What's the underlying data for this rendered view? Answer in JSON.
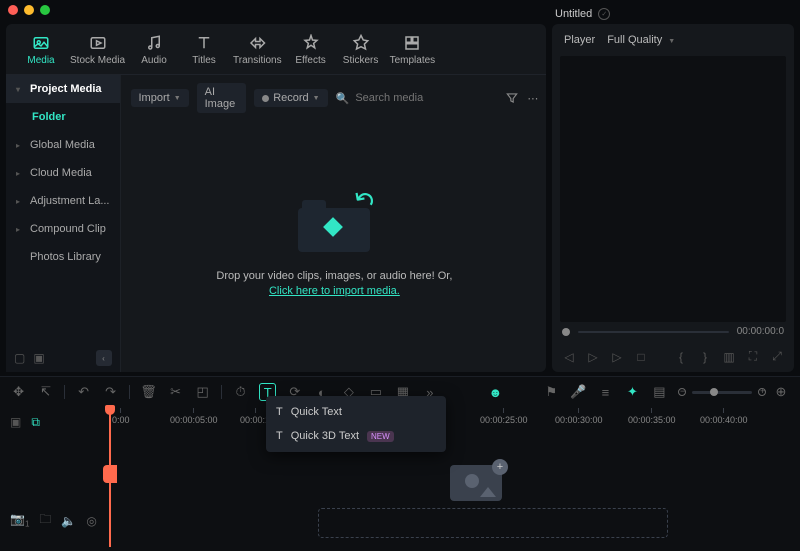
{
  "title": "Untitled",
  "tabs": [
    {
      "label": "Media"
    },
    {
      "label": "Stock Media"
    },
    {
      "label": "Audio"
    },
    {
      "label": "Titles"
    },
    {
      "label": "Transitions"
    },
    {
      "label": "Effects"
    },
    {
      "label": "Stickers"
    },
    {
      "label": "Templates"
    }
  ],
  "sidebar": {
    "project": "Project Media",
    "folder": "Folder",
    "items": [
      "Global Media",
      "Cloud Media",
      "Adjustment La...",
      "Compound Clip",
      "Photos Library"
    ]
  },
  "toolbar": {
    "import": "Import",
    "aiImage": "AI Image",
    "record": "Record",
    "searchPlaceholder": "Search media"
  },
  "dropzone": {
    "line1": "Drop your video clips, images, or audio here! Or,",
    "link": "Click here to import media."
  },
  "player": {
    "label": "Player",
    "quality": "Full Quality",
    "time": "00:00:00:0"
  },
  "timeline": {
    "marks": [
      "0:00",
      "00:00:05:00",
      "00:00:1",
      "00:00:25:00",
      "00:00:30:00",
      "00:00:35:00",
      "00:00:40:00"
    ],
    "menu": {
      "quickText": "Quick Text",
      "quick3d": "Quick 3D Text",
      "badge": "NEW"
    }
  }
}
